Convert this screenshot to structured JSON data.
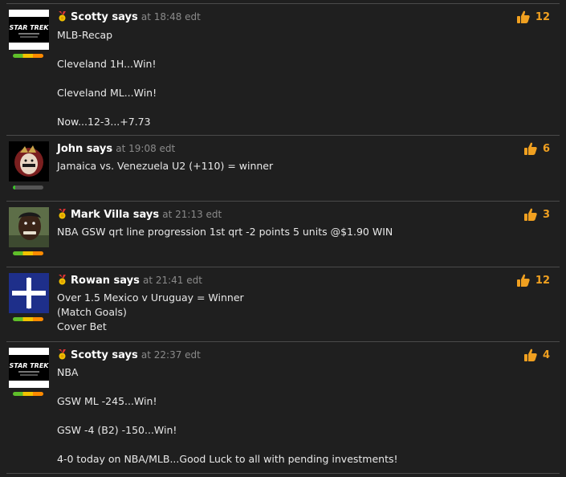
{
  "posts": [
    {
      "username": "Scotty says",
      "at_text": "at 18:48 edt",
      "body": "MLB-Recap\n\nCleveland 1H...Win!\n\nCleveland ML...Win!\n\nNow...12-3...+7.73",
      "likes": "12",
      "avatar": "star-trek-logo",
      "avatar_text": "STAR TREK",
      "badge": true,
      "reputation": 1.0
    },
    {
      "username": "John says",
      "at_text": "at 19:08 edt",
      "body": "Jamaica vs. Venezuela U2 (+110) = winner",
      "likes": "6",
      "avatar": "seminole-head-logo",
      "badge": false,
      "reputation": 0.08
    },
    {
      "username": "Mark Villa says",
      "at_text": "at 21:13 edt",
      "body": "NBA GSW qrt line progression 1st qrt -2 points 5 units @$1.90 WIN",
      "likes": "3",
      "avatar": "person-photo",
      "badge": true,
      "reputation": 1.0
    },
    {
      "username": "Rowan says",
      "at_text": "at 21:41 edt",
      "body": "Over 1.5 Mexico v Uruguay = Winner\n(Match Goals)\nCover Bet",
      "likes": "12",
      "avatar": "eureka-flag",
      "badge": true,
      "reputation": 1.0
    },
    {
      "username": "Scotty says",
      "at_text": "at 22:37 edt",
      "body": "NBA\n\nGSW ML -245...Win!\n\nGSW -4 (B2) -150...Win!\n\n4-0 today on NBA/MLB...Good Luck to all with pending investments!",
      "likes": "4",
      "avatar": "star-trek-logo",
      "avatar_text": "STAR TREK",
      "badge": true,
      "reputation": 1.0
    }
  ],
  "colors": {
    "background": "#1f1f1f",
    "likes": "#f0a020",
    "timestamp": "#8a8a8a",
    "separator": "#4a4a4a"
  }
}
